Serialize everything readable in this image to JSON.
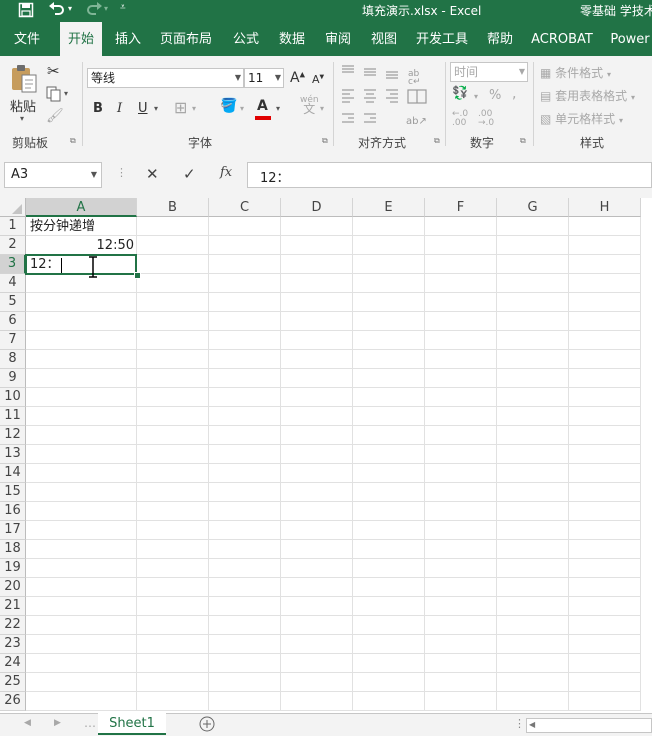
{
  "titlebar": {
    "filename": "填充演示.xlsx",
    "app": "Excel",
    "account": "零基础 学技术",
    "undo_icon": "undo-icon",
    "redo_icon": "redo-icon"
  },
  "tabs": [
    "文件",
    "开始",
    "插入",
    "页面布局",
    "公式",
    "数据",
    "审阅",
    "视图",
    "开发工具",
    "帮助",
    "ACROBAT",
    "Power"
  ],
  "active_tab": "开始",
  "ribbon": {
    "clipboard": {
      "label": "剪贴板",
      "paste": "粘贴"
    },
    "font": {
      "label": "字体",
      "name": "等线",
      "size": "11",
      "bold": "B",
      "italic": "I",
      "underline": "U",
      "grow": "A",
      "shrink": "A",
      "font_color_letter": "A",
      "wen": "wén",
      "wen_char": "文"
    },
    "alignment": {
      "label": "对齐方式"
    },
    "number": {
      "label": "数字",
      "format": "时间",
      "percent": "%"
    },
    "styles": {
      "label": "样式",
      "conditional": "条件格式",
      "table": "套用表格格式",
      "cell_styles": "单元格样式"
    }
  },
  "formula_bar": {
    "name_box": "A3",
    "content": "12："
  },
  "columns": [
    "A",
    "B",
    "C",
    "D",
    "E",
    "F",
    "G",
    "H"
  ],
  "rows": [
    "1",
    "2",
    "3",
    "4",
    "5",
    "6",
    "7",
    "8",
    "9",
    "10",
    "11",
    "12",
    "13",
    "14",
    "15",
    "16",
    "17",
    "18",
    "19",
    "20",
    "21",
    "22",
    "23",
    "24",
    "25",
    "26"
  ],
  "cells": {
    "A1": "按分钟递增",
    "A2": "12:50",
    "A3": "12："
  },
  "selected_cell": "A3",
  "sheet_tabs": [
    "Sheet1"
  ],
  "colors": {
    "excel_green": "#217346",
    "font_color_red": "#e00000"
  }
}
